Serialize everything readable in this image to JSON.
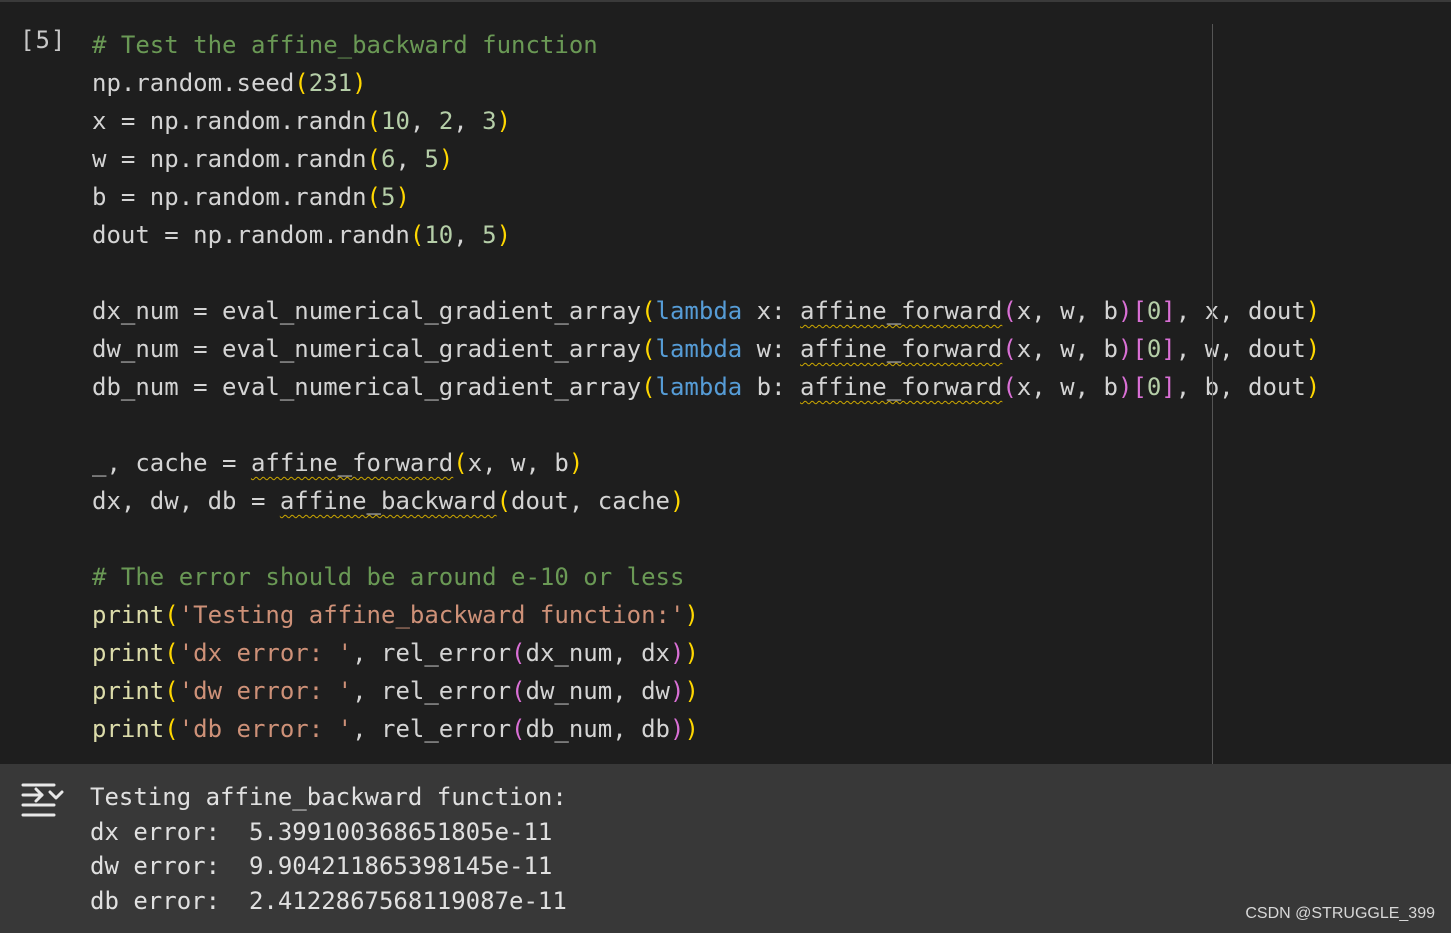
{
  "cell": {
    "execution_count": "[5]",
    "lines": [
      [
        {
          "t": "# Test the affine_backward function",
          "c": "cm"
        }
      ],
      [
        {
          "t": "np.random.seed",
          "c": "txt"
        },
        {
          "t": "(",
          "c": "pn1"
        },
        {
          "t": "231",
          "c": "num"
        },
        {
          "t": ")",
          "c": "pn1"
        }
      ],
      [
        {
          "t": "x = np.random.randn",
          "c": "txt"
        },
        {
          "t": "(",
          "c": "pn1"
        },
        {
          "t": "10",
          "c": "num"
        },
        {
          "t": ", ",
          "c": "txt"
        },
        {
          "t": "2",
          "c": "num"
        },
        {
          "t": ", ",
          "c": "txt"
        },
        {
          "t": "3",
          "c": "num"
        },
        {
          "t": ")",
          "c": "pn1"
        }
      ],
      [
        {
          "t": "w = np.random.randn",
          "c": "txt"
        },
        {
          "t": "(",
          "c": "pn1"
        },
        {
          "t": "6",
          "c": "num"
        },
        {
          "t": ", ",
          "c": "txt"
        },
        {
          "t": "5",
          "c": "num"
        },
        {
          "t": ")",
          "c": "pn1"
        }
      ],
      [
        {
          "t": "b = np.random.randn",
          "c": "txt"
        },
        {
          "t": "(",
          "c": "pn1"
        },
        {
          "t": "5",
          "c": "num"
        },
        {
          "t": ")",
          "c": "pn1"
        }
      ],
      [
        {
          "t": "dout = np.random.randn",
          "c": "txt"
        },
        {
          "t": "(",
          "c": "pn1"
        },
        {
          "t": "10",
          "c": "num"
        },
        {
          "t": ", ",
          "c": "txt"
        },
        {
          "t": "5",
          "c": "num"
        },
        {
          "t": ")",
          "c": "pn1"
        }
      ],
      [],
      [
        {
          "t": "dx_num = eval_numerical_gradient_array",
          "c": "txt"
        },
        {
          "t": "(",
          "c": "pn1"
        },
        {
          "t": "lambda",
          "c": "kw"
        },
        {
          "t": " x: ",
          "c": "txt"
        },
        {
          "t": "affine_forward",
          "c": "txt squig"
        },
        {
          "t": "(",
          "c": "pn2"
        },
        {
          "t": "x, w, b",
          "c": "txt"
        },
        {
          "t": ")",
          "c": "pn2"
        },
        {
          "t": "[",
          "c": "pn2"
        },
        {
          "t": "0",
          "c": "num"
        },
        {
          "t": "]",
          "c": "pn2"
        },
        {
          "t": ", x, dout",
          "c": "txt"
        },
        {
          "t": ")",
          "c": "pn1"
        }
      ],
      [
        {
          "t": "dw_num = eval_numerical_gradient_array",
          "c": "txt"
        },
        {
          "t": "(",
          "c": "pn1"
        },
        {
          "t": "lambda",
          "c": "kw"
        },
        {
          "t": " w: ",
          "c": "txt"
        },
        {
          "t": "affine_forward",
          "c": "txt squig"
        },
        {
          "t": "(",
          "c": "pn2"
        },
        {
          "t": "x, w, b",
          "c": "txt"
        },
        {
          "t": ")",
          "c": "pn2"
        },
        {
          "t": "[",
          "c": "pn2"
        },
        {
          "t": "0",
          "c": "num"
        },
        {
          "t": "]",
          "c": "pn2"
        },
        {
          "t": ", w, dout",
          "c": "txt"
        },
        {
          "t": ")",
          "c": "pn1"
        }
      ],
      [
        {
          "t": "db_num = eval_numerical_gradient_array",
          "c": "txt"
        },
        {
          "t": "(",
          "c": "pn1"
        },
        {
          "t": "lambda",
          "c": "kw"
        },
        {
          "t": " b: ",
          "c": "txt"
        },
        {
          "t": "affine_forward",
          "c": "txt squig"
        },
        {
          "t": "(",
          "c": "pn2"
        },
        {
          "t": "x, w, b",
          "c": "txt"
        },
        {
          "t": ")",
          "c": "pn2"
        },
        {
          "t": "[",
          "c": "pn2"
        },
        {
          "t": "0",
          "c": "num"
        },
        {
          "t": "]",
          "c": "pn2"
        },
        {
          "t": ", b, dout",
          "c": "txt"
        },
        {
          "t": ")",
          "c": "pn1"
        }
      ],
      [],
      [
        {
          "t": "_, cache = ",
          "c": "txt"
        },
        {
          "t": "affine_forward",
          "c": "txt squig"
        },
        {
          "t": "(",
          "c": "pn1"
        },
        {
          "t": "x, w, b",
          "c": "txt"
        },
        {
          "t": ")",
          "c": "pn1"
        }
      ],
      [
        {
          "t": "dx, dw, db = ",
          "c": "txt"
        },
        {
          "t": "affine_backward",
          "c": "txt squig"
        },
        {
          "t": "(",
          "c": "pn1"
        },
        {
          "t": "dout, cache",
          "c": "txt"
        },
        {
          "t": ")",
          "c": "pn1"
        }
      ],
      [],
      [
        {
          "t": "# The error should be around e-10 or less",
          "c": "cm"
        }
      ],
      [
        {
          "t": "print",
          "c": "fn"
        },
        {
          "t": "(",
          "c": "pn1"
        },
        {
          "t": "'Testing affine_backward function:'",
          "c": "str"
        },
        {
          "t": ")",
          "c": "pn1"
        }
      ],
      [
        {
          "t": "print",
          "c": "fn"
        },
        {
          "t": "(",
          "c": "pn1"
        },
        {
          "t": "'dx error: '",
          "c": "str"
        },
        {
          "t": ", rel_error",
          "c": "txt"
        },
        {
          "t": "(",
          "c": "pn2"
        },
        {
          "t": "dx_num, dx",
          "c": "txt"
        },
        {
          "t": ")",
          "c": "pn2"
        },
        {
          "t": ")",
          "c": "pn1"
        }
      ],
      [
        {
          "t": "print",
          "c": "fn"
        },
        {
          "t": "(",
          "c": "pn1"
        },
        {
          "t": "'dw error: '",
          "c": "str"
        },
        {
          "t": ", rel_error",
          "c": "txt"
        },
        {
          "t": "(",
          "c": "pn2"
        },
        {
          "t": "dw_num, dw",
          "c": "txt"
        },
        {
          "t": ")",
          "c": "pn2"
        },
        {
          "t": ")",
          "c": "pn1"
        }
      ],
      [
        {
          "t": "print",
          "c": "fn"
        },
        {
          "t": "(",
          "c": "pn1"
        },
        {
          "t": "'db error: '",
          "c": "str"
        },
        {
          "t": ", rel_error",
          "c": "txt"
        },
        {
          "t": "(",
          "c": "pn2"
        },
        {
          "t": "db_num, db",
          "c": "txt"
        },
        {
          "t": ")",
          "c": "pn2"
        },
        {
          "t": ")",
          "c": "pn1"
        }
      ]
    ]
  },
  "output": {
    "icon": "output-toggle-icon",
    "lines": [
      "Testing affine_backward function:",
      "dx error:  5.399100368651805e-11",
      "dw error:  9.904211865398145e-11",
      "db error:  2.4122867568119087e-11"
    ]
  },
  "watermark": "CSDN @STRUGGLE_399",
  "colors": {
    "background": "#1e1e1e",
    "output_background": "#383838",
    "comment": "#6a9955",
    "keyword": "#569cd6",
    "function": "#dcdcaa",
    "string": "#ce9178",
    "number": "#b5cea8",
    "bracket_level1": "#ffd700",
    "bracket_level2": "#da70d6",
    "squiggle": "#cca700"
  }
}
